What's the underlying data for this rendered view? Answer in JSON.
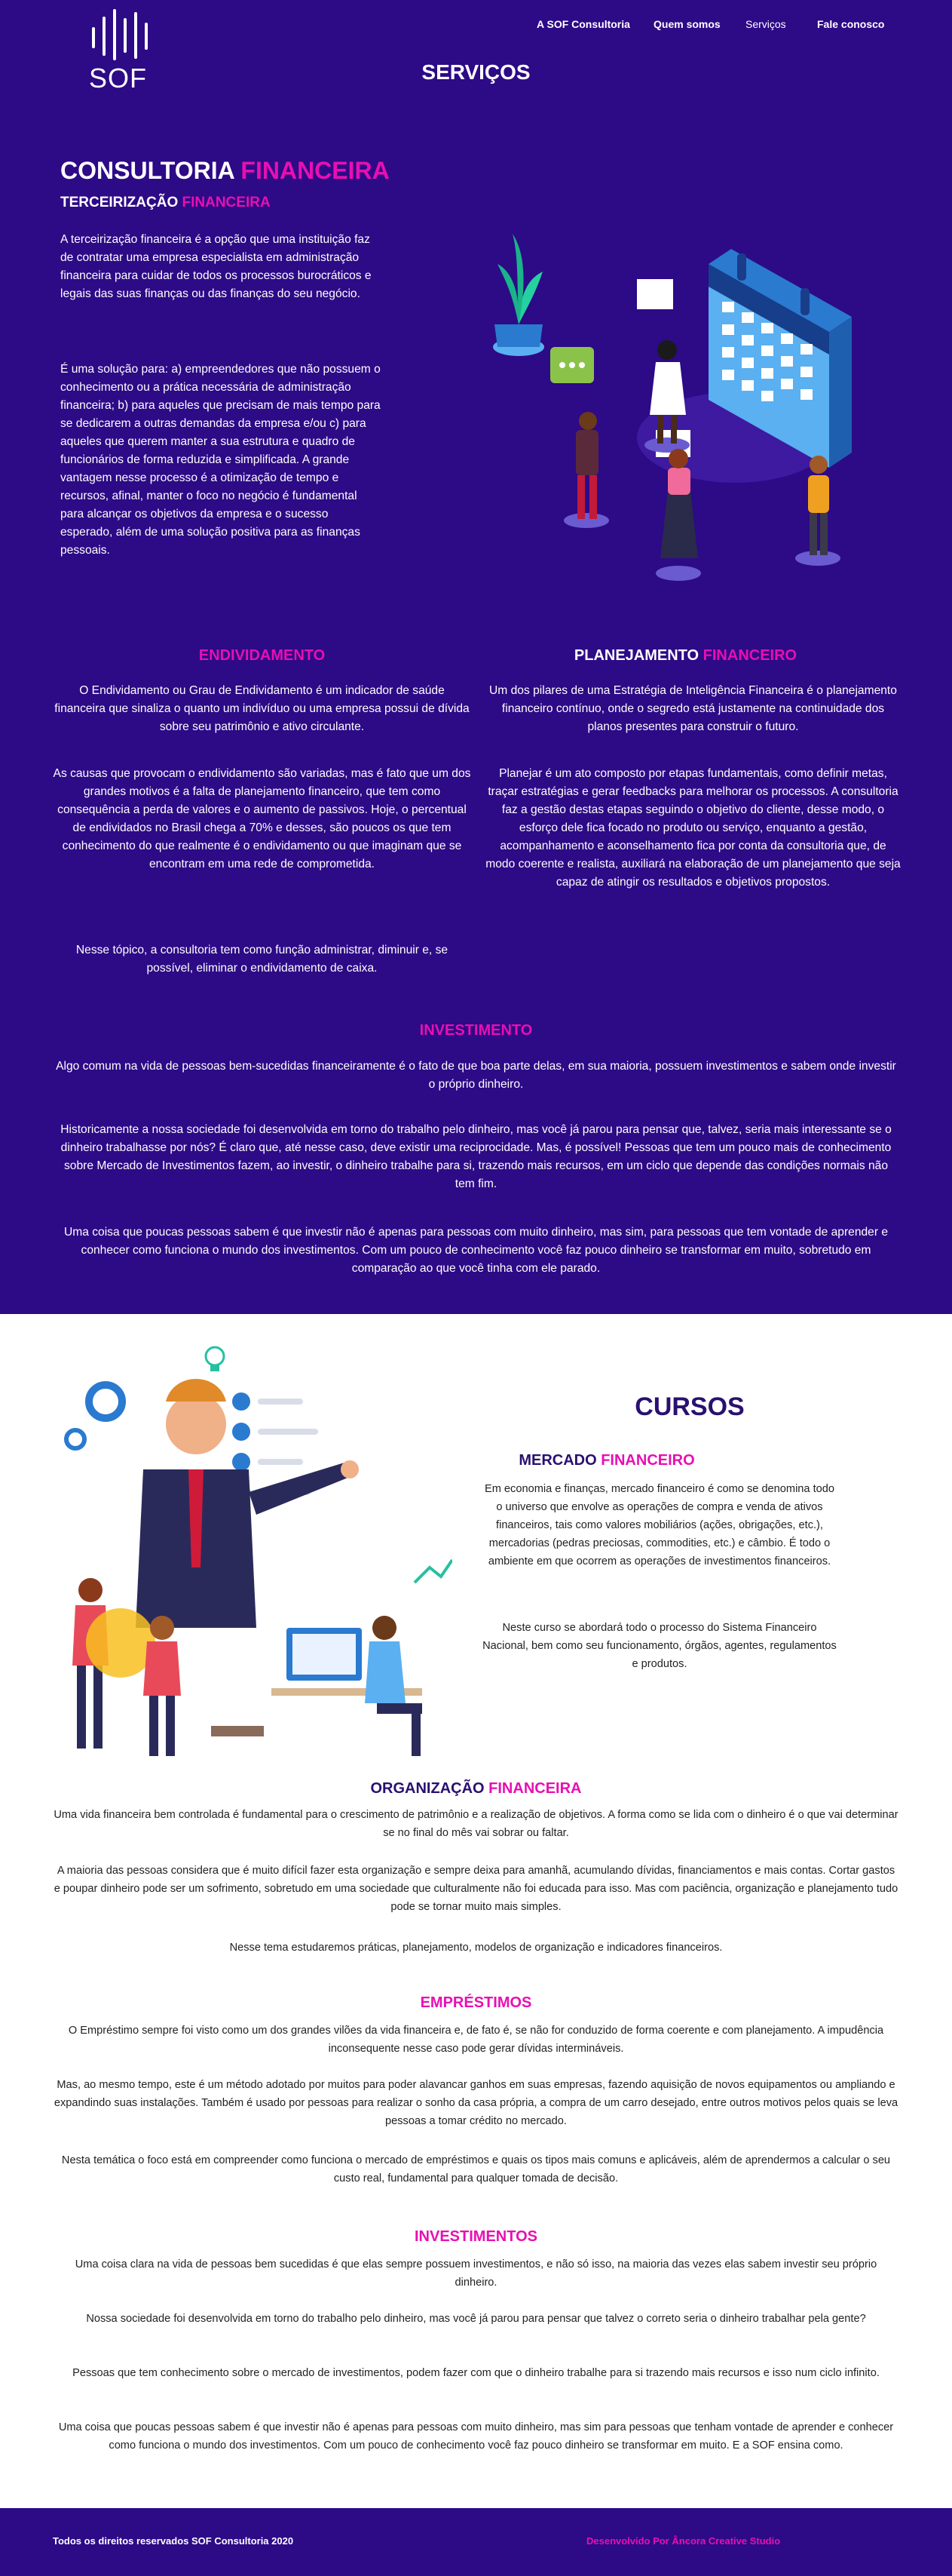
{
  "nav": {
    "logo_text": "SOF",
    "items": [
      "A SOF Consultoria",
      "Quem somos",
      "Serviços",
      "Fale conosco"
    ]
  },
  "hero": {
    "page_title": "SERVIÇOS",
    "consultoria": {
      "title_a": "CONSULTORIA ",
      "title_b": "FINANCEIRA",
      "sub_a": "TERCEIRIZAÇÃO ",
      "sub_b": "FINANCEIRA",
      "p1": "A terceirização financeira é a opção que uma instituição faz de contratar uma empresa especialista em administração financeira para cuidar de todos os processos burocráticos e legais das suas finanças ou das finanças do seu negócio.",
      "p2": "É uma solução para: a) empreendedores que não possuem o conhecimento ou a prática necessária de administração financeira; b) para aqueles que precisam de mais tempo para se dedicarem a outras demandas da empresa e/ou c) para aqueles que querem manter a sua estrutura e quadro de funcionários de forma reduzida e simplificada. A grande vantagem nesse processo é a otimização de tempo e recursos, afinal, manter o foco no negócio é fundamental para alcançar os objetivos da empresa e o sucesso esperado, além de uma solução positiva para as finanças pessoais."
    },
    "endividamento": {
      "title": "ENDIVIDAMENTO",
      "p1": "O Endividamento ou Grau de Endividamento é um indicador de saúde financeira que sinaliza o quanto um indivíduo ou uma empresa possui de dívida sobre seu patrimônio e ativo circulante.",
      "p2": "As causas que provocam o endividamento são variadas, mas é fato que um dos grandes motivos é a falta de planejamento financeiro, que tem como consequência a perda de valores e o aumento de passivos.  Hoje, o percentual de endividados no Brasil chega a 70% e desses, são poucos os que tem conhecimento do que realmente é o endividamento ou que imaginam que se encontram em uma rede de comprometida.",
      "p3": "Nesse tópico, a consultoria tem como função administrar, diminuir e, se possível, eliminar o endividamento de caixa."
    },
    "planejamento": {
      "title_a": "PLANEJAMENTO ",
      "title_b": "FINANCEIRO",
      "p1": "Um dos pilares de uma Estratégia de Inteligência Financeira é o planejamento financeiro contínuo, onde o segredo está justamente na continuidade dos planos presentes para construir o futuro.",
      "p2": "Planejar é um ato composto por etapas fundamentais, como definir metas, traçar estratégias e gerar feedbacks para melhorar os processos.  A consultoria faz a gestão destas etapas seguindo o objetivo do cliente, desse modo, o esforço dele fica focado no produto ou serviço, enquanto a gestão, acompanhamento e aconselhamento fica por conta da consultoria que, de modo coerente e realista, auxiliará na elaboração de um planejamento que seja capaz de atingir os resultados e objetivos propostos."
    },
    "investimento": {
      "title": "INVESTIMENTO",
      "p1": "Algo comum na vida de pessoas bem-sucedidas financeiramente é o fato de que boa parte delas, em sua maioria, possuem investimentos e sabem onde investir o próprio dinheiro.",
      "p2": "Historicamente a nossa sociedade foi desenvolvida em torno do trabalho pelo dinheiro, mas você já parou para pensar que, talvez, seria mais interessante se o dinheiro trabalhasse por nós? É claro que, até nesse caso, deve existir uma reciprocidade. Mas, é possível! Pessoas que tem um pouco mais de conhecimento sobre Mercado de Investimentos fazem, ao investir, o dinheiro trabalhe para si, trazendo mais recursos, em um ciclo que depende das condições normais não tem fim.",
      "p3": "Uma coisa que poucas pessoas sabem é que investir não é apenas para pessoas com muito dinheiro, mas sim, para pessoas que tem vontade de aprender e conhecer como funciona o mundo dos investimentos. Com um pouco de conhecimento você faz pouco dinheiro se transformar em muito, sobretudo em comparação ao que você tinha com ele parado."
    }
  },
  "cursos": {
    "title": "CURSOS",
    "mercado": {
      "title_a": "MERCADO ",
      "title_b": "FINANCEIRO",
      "p1": "Em economia e finanças, mercado financeiro é como se denomina todo o universo que envolve as operações de compra e venda de ativos financeiros, tais como valores mobiliários (ações, obrigações, etc.), mercadorias (pedras preciosas, commodities, etc.) e câmbio. É todo o ambiente em que ocorrem as operações de investimentos financeiros.",
      "p2": "Neste curso se abordará todo o processo do Sistema Financeiro Nacional, bem como seu funcionamento, órgãos, agentes, regulamentos e produtos."
    },
    "organizacao": {
      "title_a": "ORGANIZAÇÃO ",
      "title_b": "FINANCEIRA",
      "p1": "Uma vida financeira bem controlada é fundamental para o crescimento de patrimônio e a realização de objetivos. A forma como se lida com o dinheiro é o que vai determinar se no final do mês vai sobrar ou faltar.",
      "p2": "A maioria das pessoas considera que é muito difícil fazer esta organização e sempre deixa para amanhã, acumulando dívidas, financiamentos e mais contas. Cortar gastos e poupar dinheiro pode ser um sofrimento, sobretudo em uma sociedade que culturalmente não foi educada para isso. Mas com paciência, organização e planejamento tudo pode se tornar muito mais simples.",
      "p3": "Nesse tema estudaremos práticas, planejamento, modelos de organização e indicadores financeiros."
    },
    "emprestimos": {
      "title": "EMPRÉSTIMOS",
      "p1": "O Empréstimo sempre foi visto como um dos grandes vilões da vida financeira e, de fato é, se não for conduzido de forma coerente e com planejamento. A impudência inconsequente nesse caso pode gerar dívidas intermináveis.",
      "p2": "Mas, ao mesmo tempo, este é um método adotado por muitos para poder alavancar ganhos em suas empresas, fazendo aquisição de novos equipamentos ou ampliando e expandindo suas instalações. Também é usado por pessoas para realizar o sonho da casa própria, a compra de um carro desejado, entre outros motivos pelos quais se leva pessoas a tomar crédito no mercado.",
      "p3": "Nesta temática o foco está em compreender como funciona o mercado de empréstimos e quais os tipos mais comuns e aplicáveis, além de aprendermos a calcular o seu custo real, fundamental para qualquer tomada de decisão."
    },
    "investimentos": {
      "title": "INVESTIMENTOS",
      "p1": "Uma coisa clara na vida de pessoas bem sucedidas é que elas sempre possuem investimentos, e não só isso, na maioria das vezes elas sabem investir seu próprio dinheiro.",
      "p2": "Nossa sociedade foi desenvolvida em torno do trabalho pelo dinheiro, mas você já parou para pensar que talvez o correto seria o dinheiro trabalhar pela gente?",
      "p3": "Pessoas que tem conhecimento sobre o mercado de investimentos, podem fazer com que o dinheiro trabalhe para si trazendo mais recursos e isso num ciclo infinito.",
      "p4": "Uma coisa que poucas pessoas sabem é que investir não é apenas para pessoas com muito dinheiro, mas sim para pessoas que tenham vontade de aprender e conhecer como funciona o mundo dos investimentos. Com um pouco de conhecimento você faz pouco dinheiro se transformar em muito. E a SOF ensina como."
    }
  },
  "footer": {
    "copyright": "Todos os direitos reservados SOF Consultoria 2020",
    "credit": "Desenvolvido Por Âncora Creative Studio"
  },
  "colors": {
    "purple": "#2d0a86",
    "pink": "#e80fb2",
    "heading_dark": "#2a1070"
  }
}
